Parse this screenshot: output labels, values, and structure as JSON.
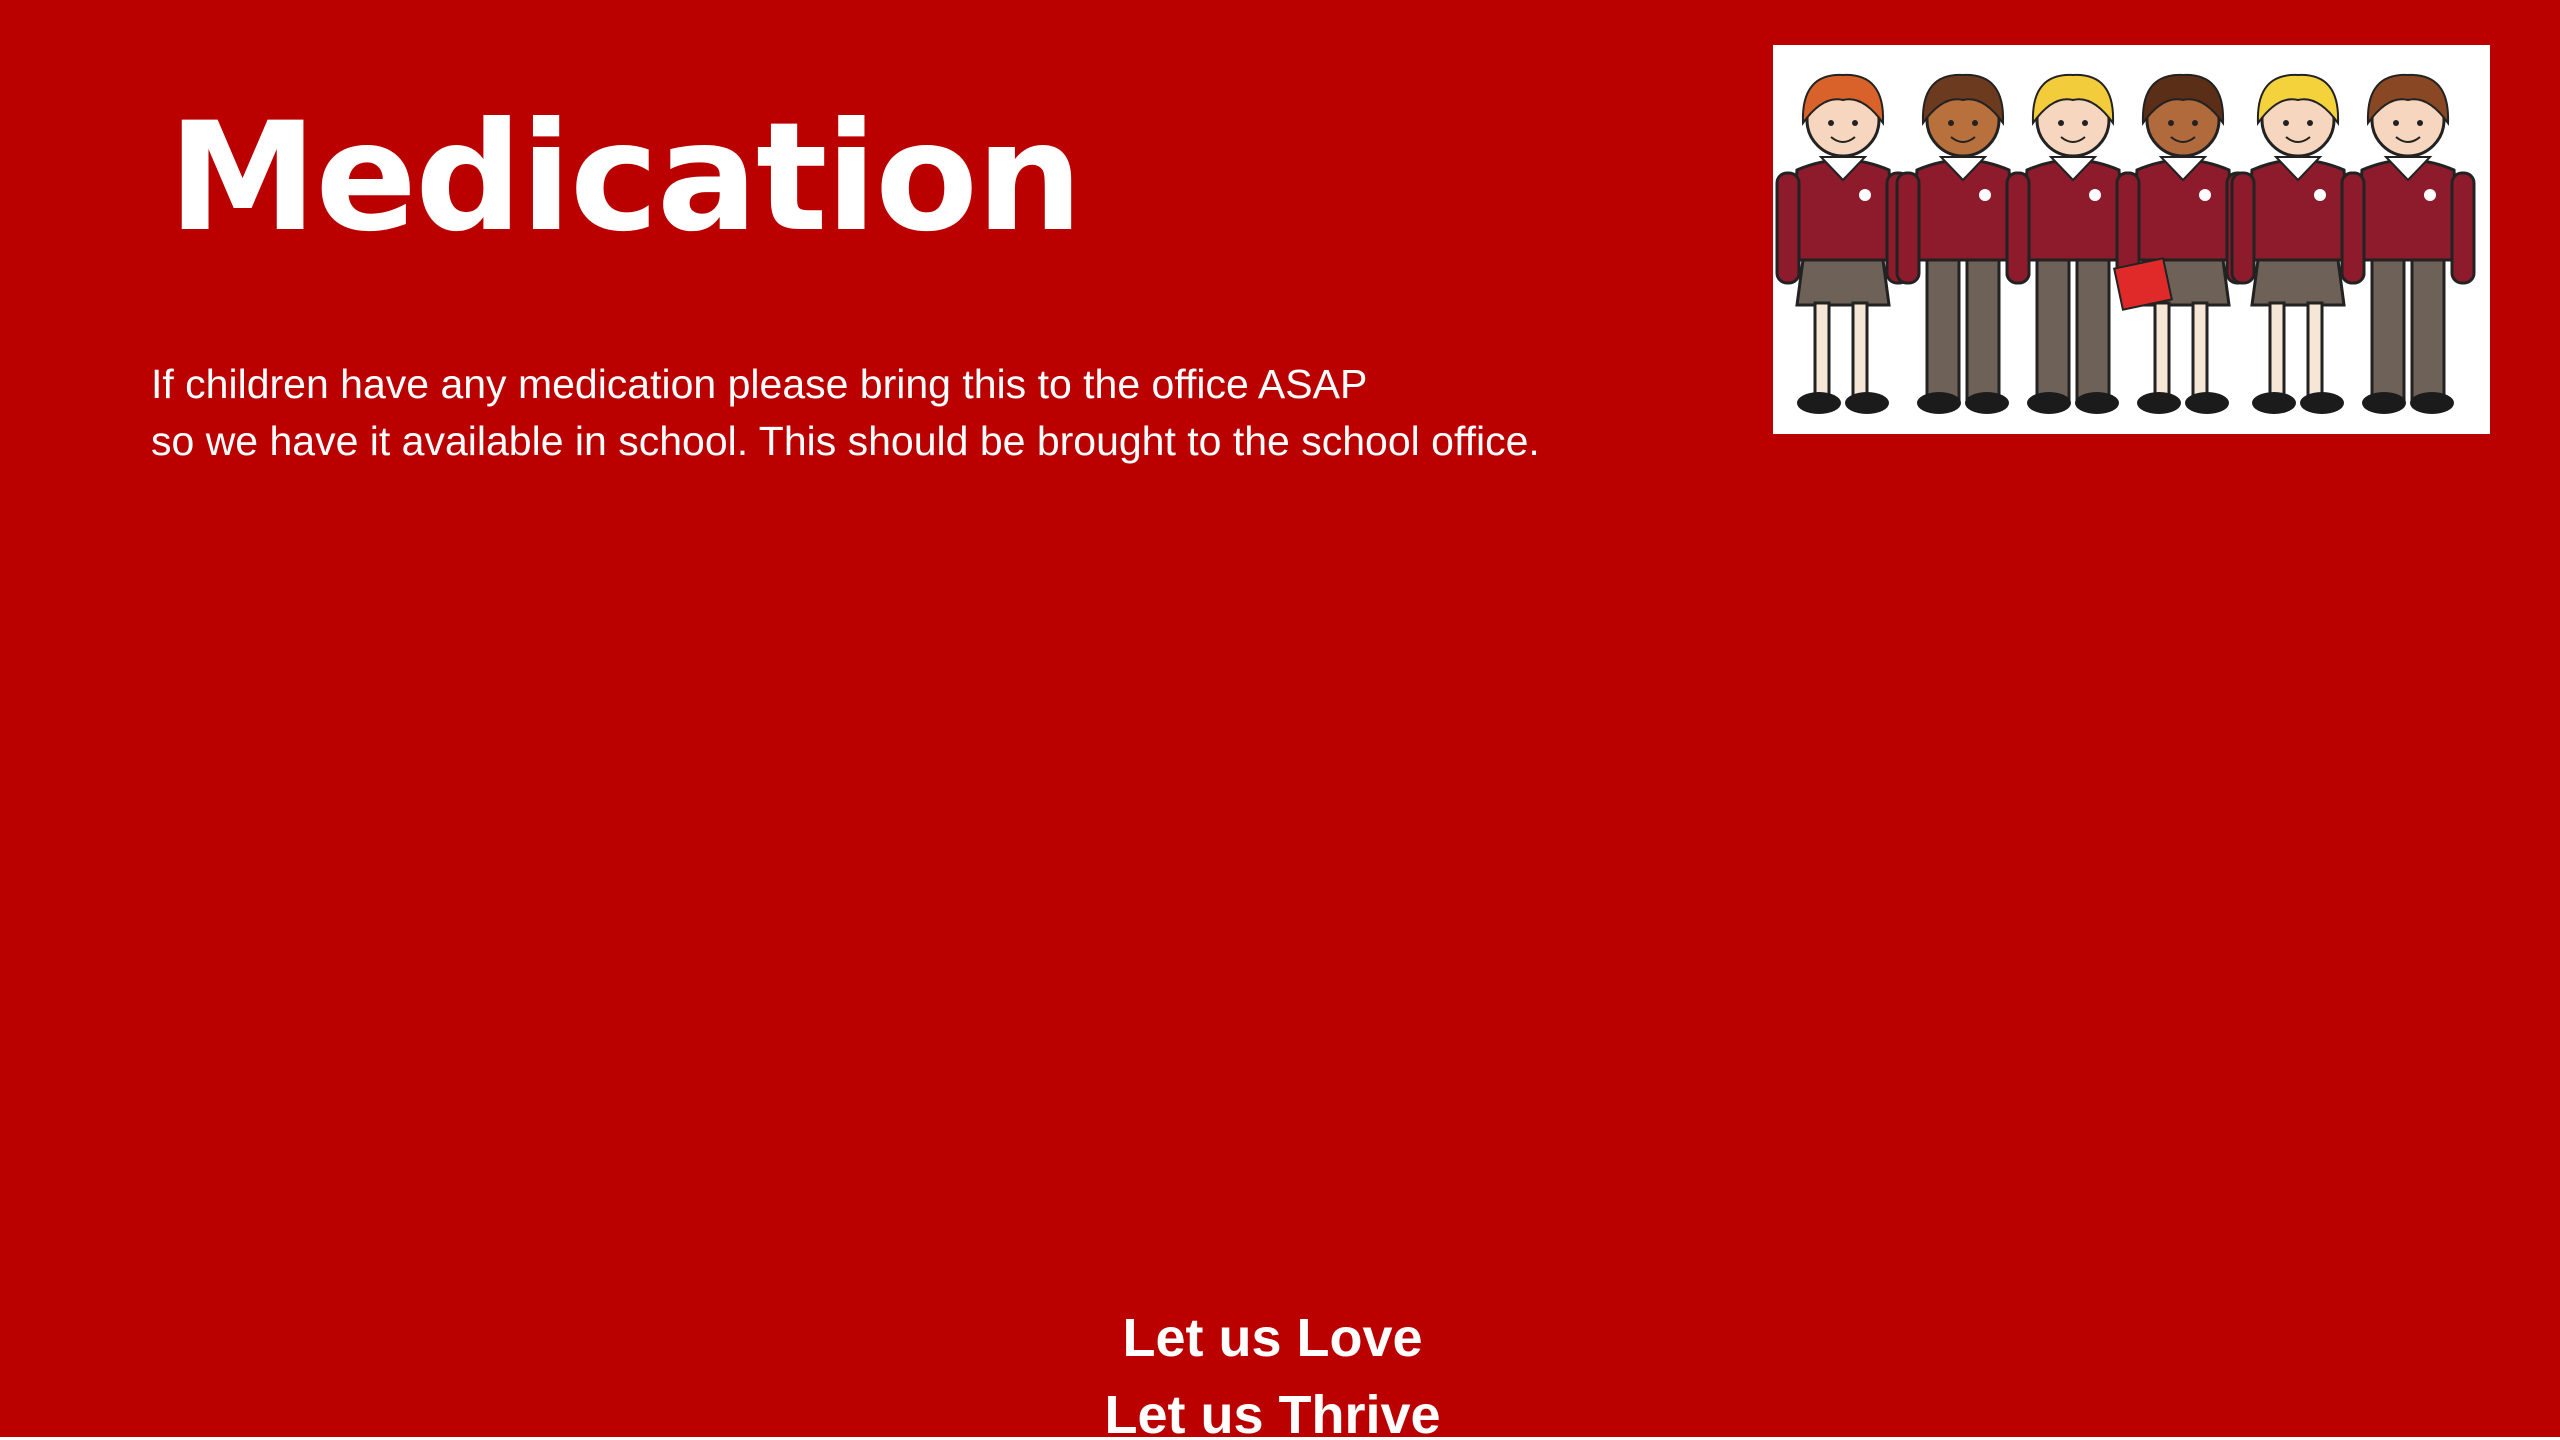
{
  "slide": {
    "title": "Medication",
    "body_lines": [
      "If children have any medication please bring this to the office ASAP",
      "so we have it available in school. This should be brought to the school office."
    ],
    "footer_lines": [
      "Let us Love",
      "Let us Thrive"
    ],
    "image": {
      "icon": "school-children-illustration-icon",
      "subject": "group of school children in red uniforms"
    }
  },
  "colors": {
    "background": "#bb0000",
    "text": "#ffffff",
    "uniform": "#8e1b2c",
    "trousers": "#6e6258"
  }
}
